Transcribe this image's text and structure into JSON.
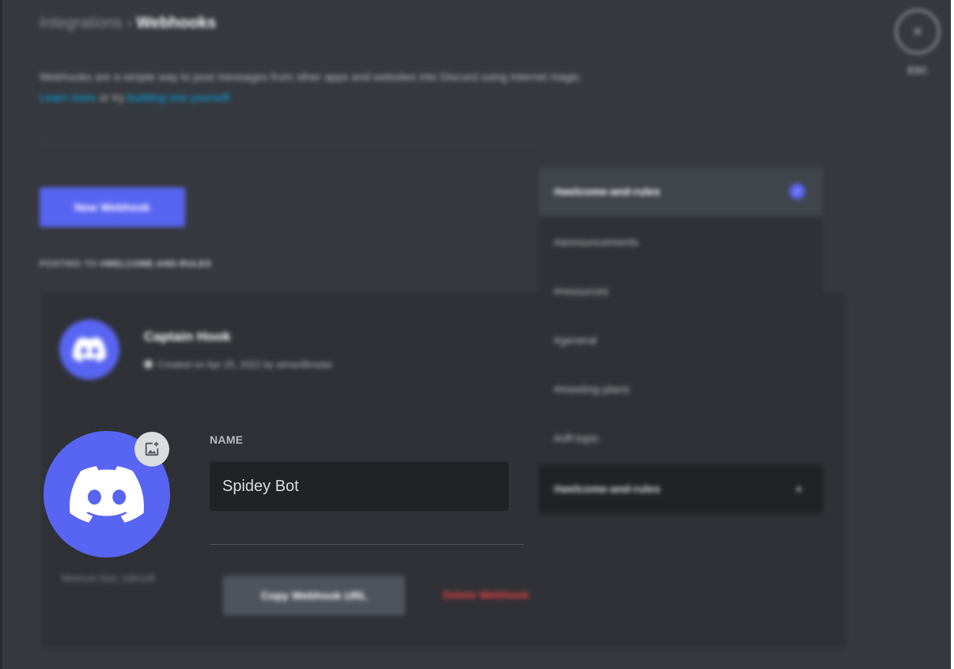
{
  "header": {
    "breadcrumb_parent": "Integrations",
    "breadcrumb_separator": "›",
    "breadcrumb_current": "Webhooks",
    "description": "Webhooks are a simple way to post messages from other apps and websites into Discord using internet magic.",
    "learn_more_link": "Learn more",
    "or_text": "or try",
    "build_link": "building one yourself."
  },
  "close": {
    "icon": "×",
    "esc_label": "ESC"
  },
  "toolbar": {
    "new_webhook_label": "New Webhook",
    "posting_label_prefix": "POSTING TO",
    "posting_channel": "#WELCOME-AND-RULES"
  },
  "webhook": {
    "name": "Captain Hook",
    "meta": "Created on Apr 25, 2022 by aimanBiradar",
    "name_label": "NAME",
    "name_value": "Spidey Bot",
    "min_size": "Minimum Size: 128x128",
    "copy_url_label": "Copy Webhook URL",
    "delete_label": "Delete Webhook"
  },
  "channel_dropdown": {
    "selected": "#welcome-and-rules",
    "check_icon": "✓",
    "options": [
      "#announcements",
      "#resources",
      "#general",
      "#meeting-plans",
      "#off-topic"
    ],
    "select_value": "#welcome-and-rules",
    "chevron_icon": "▲"
  },
  "colors": {
    "background": "#36393f",
    "card": "#2f3136",
    "input": "#202225",
    "blurple": "#5865f2",
    "danger": "#ed4245",
    "link": "#00aff4"
  }
}
